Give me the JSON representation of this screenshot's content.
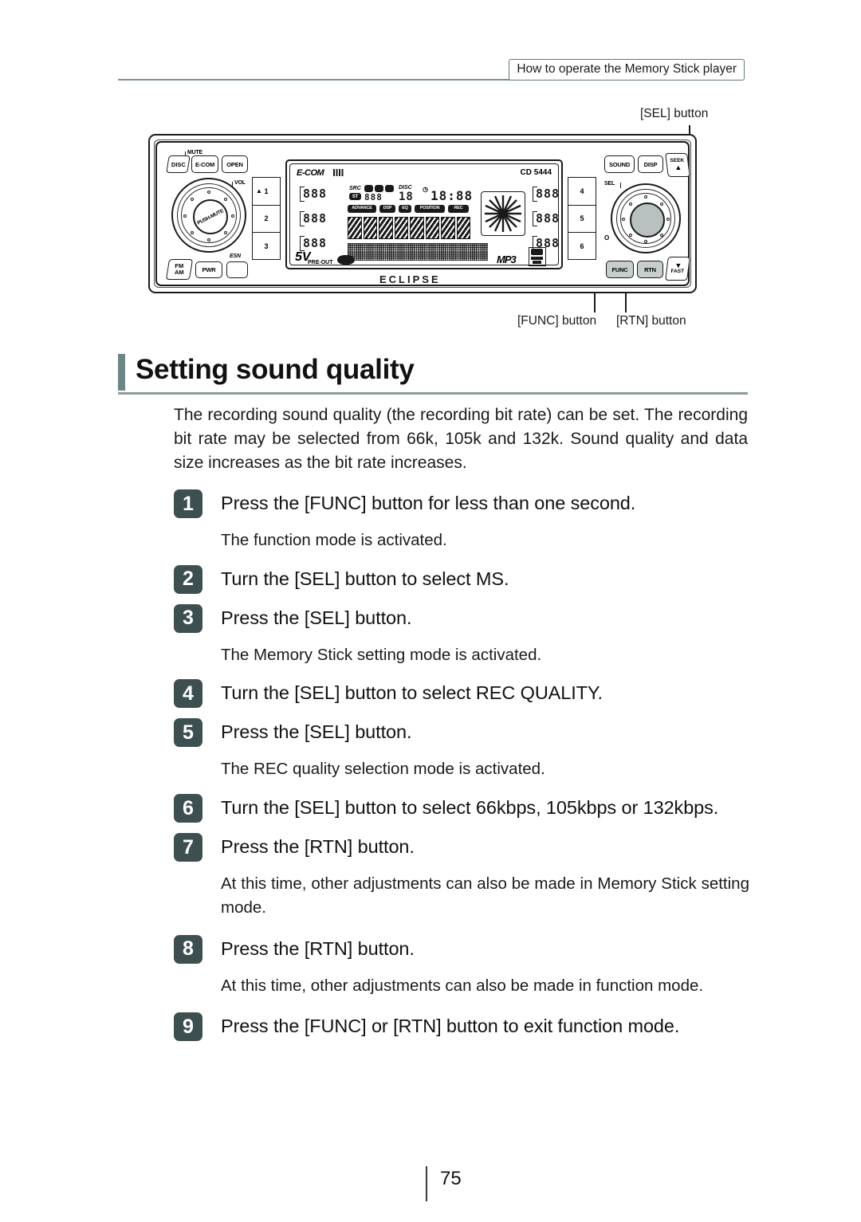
{
  "header": {
    "tab_label": "How to operate the Memory Stick player"
  },
  "figure": {
    "callouts": {
      "sel": "[SEL] button",
      "func": "[FUNC] button",
      "rtn": "[RTN] button"
    },
    "unit": {
      "brand": "ECLIPSE",
      "model": "CD 5444",
      "left_buttons": [
        "DISC",
        "E-COM",
        "OPEN"
      ],
      "left_labels": {
        "mute": "MUTE",
        "vol": "VOL",
        "esn": "ESN"
      },
      "volume_knob_label": "PUSH-MUTE",
      "bottom_left_buttons": [
        "FM\nAM",
        "PWR"
      ],
      "right_buttons": [
        "SOUND",
        "DISP"
      ],
      "seek_label": "SEEK",
      "fast_label": "FAST",
      "sel_label": "SEL",
      "sel_dot": "O",
      "bottom_right_buttons": [
        "FUNC",
        "RTN"
      ],
      "preset_left": [
        "1",
        "2",
        "3"
      ],
      "preset_right": [
        "4",
        "5",
        "6"
      ],
      "eject_icon": "eject"
    },
    "lcd": {
      "ecom": "E-COM",
      "model": "CD 5444",
      "src": "SRC",
      "st": "ST",
      "disc": "DISC",
      "disc_num": "18",
      "clock": "18:88",
      "indicators": [
        "ADVANCE",
        "DSP",
        "EQ",
        "POSITION",
        "REC"
      ],
      "seg_left": [
        "888",
        "888",
        "888"
      ],
      "seg_right": [
        "888",
        "888",
        "888"
      ],
      "preout": "PRE-OUT",
      "volt": "5V",
      "mp3": "MP3",
      "cd_logo": "COMPACT DISC DIGITAL AUDIO TEXT"
    }
  },
  "title": "Setting sound quality",
  "intro": "The recording sound quality (the recording bit rate) can be set. The recording bit rate may be selected from 66k, 105k and 132k. Sound quality and data size increases as the bit rate increases.",
  "steps": [
    {
      "num": "1",
      "text": "Press the [FUNC] button for less than one second.",
      "note": "The function mode is activated."
    },
    {
      "num": "2",
      "text": "Turn the [SEL] button to select MS.",
      "note": null
    },
    {
      "num": "3",
      "text": "Press the [SEL] button.",
      "note": "The Memory Stick setting mode is activated."
    },
    {
      "num": "4",
      "text": "Turn the [SEL] button to select REC QUALITY.",
      "note": null
    },
    {
      "num": "5",
      "text": "Press the [SEL] button.",
      "note": "The REC quality selection mode is activated."
    },
    {
      "num": "6",
      "text": "Turn the [SEL] button to select 66kbps, 105kbps or 132kbps.",
      "note": null
    },
    {
      "num": "7",
      "text": "Press the [RTN] button.",
      "note": "At this time, other adjustments can also be made in Memory Stick setting mode."
    },
    {
      "num": "8",
      "text": "Press the [RTN] button.",
      "note": "At this time, other adjustments can also be made in function mode."
    },
    {
      "num": "9",
      "text": "Press the [FUNC] or [RTN] button to exit function mode.",
      "note": null
    }
  ],
  "footer": {
    "page_number": "75"
  },
  "colors": {
    "title_bar": "#6e8585",
    "step_box": "#3e4f4f",
    "rule": "#8b9c9c"
  }
}
